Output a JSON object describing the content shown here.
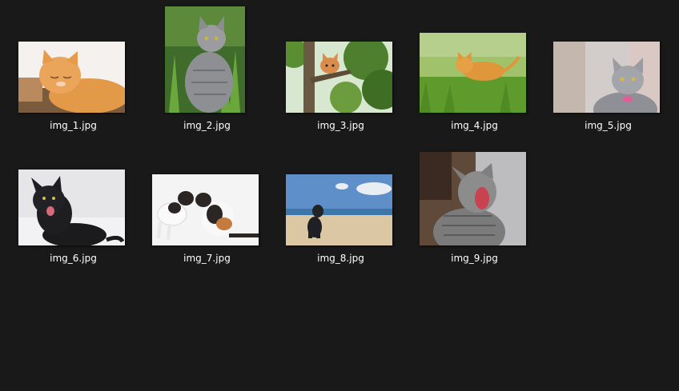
{
  "files": [
    {
      "name": "img_1.jpg",
      "icon": "orange-cat-sleeping-thumbnail"
    },
    {
      "name": "img_2.jpg",
      "icon": "gray-tabby-in-grass-thumbnail"
    },
    {
      "name": "img_3.jpg",
      "icon": "kitten-in-tree-thumbnail"
    },
    {
      "name": "img_4.jpg",
      "icon": "orange-cat-on-grass-thumbnail"
    },
    {
      "name": "img_5.jpg",
      "icon": "gray-cat-pink-collar-thumbnail"
    },
    {
      "name": "img_6.jpg",
      "icon": "black-kitten-thumbnail"
    },
    {
      "name": "img_7.jpg",
      "icon": "cats-on-white-thumbnail"
    },
    {
      "name": "img_8.jpg",
      "icon": "dog-on-beach-thumbnail"
    },
    {
      "name": "img_9.jpg",
      "icon": "yawning-tabby-thumbnail"
    }
  ]
}
